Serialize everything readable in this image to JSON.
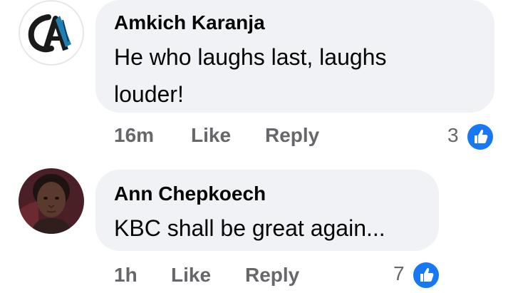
{
  "comments": [
    {
      "author": "Amkich Karanja",
      "text": "He who laughs last, laughs louder!",
      "time": "16m",
      "like_label": "Like",
      "reply_label": "Reply",
      "reaction_count": "3",
      "avatar_icon": "logo-avatar-icon"
    },
    {
      "author": "Ann Chepkoech",
      "text": "KBC shall be great again...",
      "time": "1h",
      "like_label": "Like",
      "reply_label": "Reply",
      "reaction_count": "7",
      "avatar_icon": "profile-photo-avatar"
    }
  ],
  "colors": {
    "bubble": "#f0f2f5",
    "meta_text": "#65676b",
    "like_blue": "#1877f2"
  }
}
